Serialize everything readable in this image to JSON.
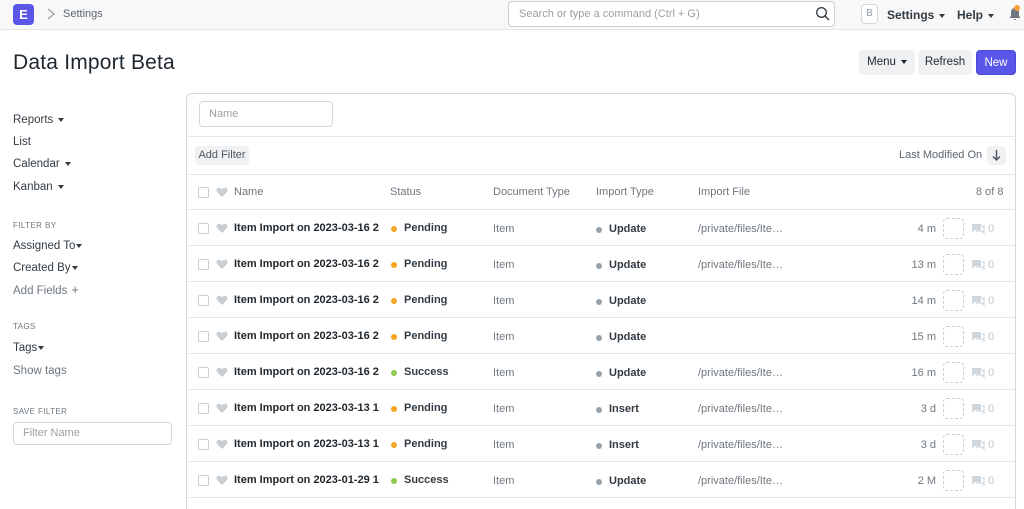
{
  "navbar": {
    "logo_letter": "E",
    "breadcrumb": "Settings",
    "search_placeholder": "Search or type a command (Ctrl + G)",
    "avatar_letter": "B",
    "settings_label": "Settings",
    "help_label": "Help"
  },
  "page": {
    "title": "Data Import Beta",
    "menu_label": "Menu",
    "refresh_label": "Refresh",
    "new_label": "New"
  },
  "sidebar": {
    "reports": "Reports",
    "list": "List",
    "calendar": "Calendar",
    "kanban": "Kanban",
    "filter_by": "FILTER BY",
    "assigned_to": "Assigned To",
    "created_by": "Created By",
    "add_fields": "Add Fields",
    "tags_head": "TAGS",
    "tags": "Tags",
    "show_tags": "Show tags",
    "save_filter": "SAVE FILTER",
    "filter_name_placeholder": "Filter Name"
  },
  "list": {
    "name_filter_placeholder": "Name",
    "add_filter": "Add Filter",
    "sort_label": "Last Modified On",
    "columns": {
      "name": "Name",
      "status": "Status",
      "document_type": "Document Type",
      "import_type": "Import Type",
      "import_file": "Import File"
    },
    "count": "8 of 8",
    "rows": [
      {
        "name": "Item Import on 2023-03-16 2",
        "status": "Pending",
        "document_type": "Item",
        "import_type": "Update",
        "import_file": "/private/files/Ite…",
        "modified": "4 m",
        "comments": "0"
      },
      {
        "name": "Item Import on 2023-03-16 2",
        "status": "Pending",
        "document_type": "Item",
        "import_type": "Update",
        "import_file": "/private/files/Ite…",
        "modified": "13 m",
        "comments": "0"
      },
      {
        "name": "Item Import on 2023-03-16 2",
        "status": "Pending",
        "document_type": "Item",
        "import_type": "Update",
        "import_file": "",
        "modified": "14 m",
        "comments": "0"
      },
      {
        "name": "Item Import on 2023-03-16 2",
        "status": "Pending",
        "document_type": "Item",
        "import_type": "Update",
        "import_file": "",
        "modified": "15 m",
        "comments": "0"
      },
      {
        "name": "Item Import on 2023-03-16 2",
        "status": "Success",
        "document_type": "Item",
        "import_type": "Update",
        "import_file": "/private/files/Ite…",
        "modified": "16 m",
        "comments": "0"
      },
      {
        "name": "Item Import on 2023-03-13 1",
        "status": "Pending",
        "document_type": "Item",
        "import_type": "Insert",
        "import_file": "/private/files/Ite…",
        "modified": "3 d",
        "comments": "0"
      },
      {
        "name": "Item Import on 2023-03-13 1",
        "status": "Pending",
        "document_type": "Item",
        "import_type": "Insert",
        "import_file": "/private/files/Ite…",
        "modified": "3 d",
        "comments": "0"
      },
      {
        "name": "Item Import on 2023-01-29 1",
        "status": "Success",
        "document_type": "Item",
        "import_type": "Update",
        "import_file": "/private/files/Ite…",
        "modified": "2 M",
        "comments": "0"
      }
    ]
  },
  "colors": {
    "primary": "#5A56E8",
    "pending": "#F6A623",
    "success": "#8BCB4F",
    "neutral_dot": "#98A1A9"
  }
}
